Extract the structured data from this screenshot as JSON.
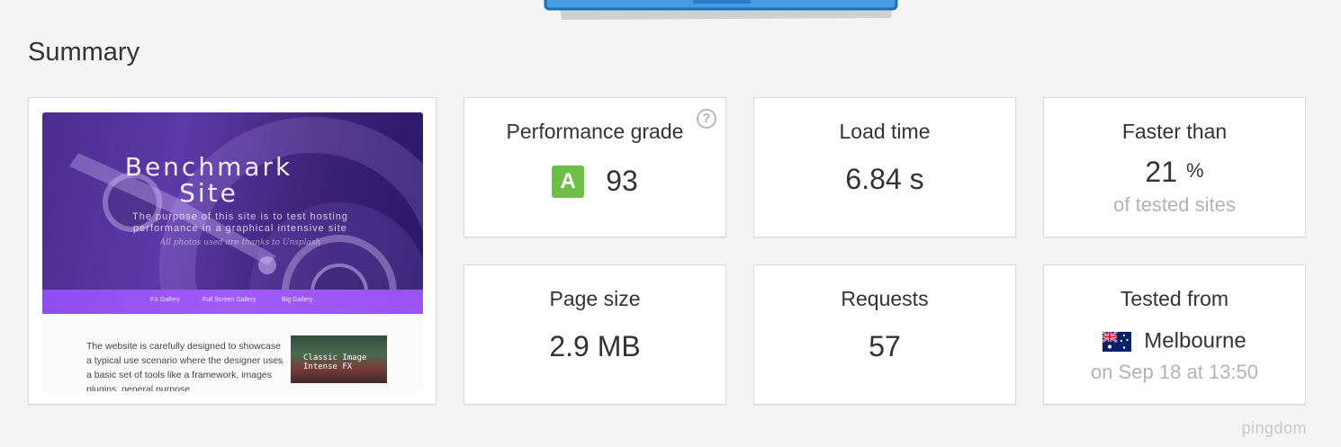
{
  "summary": {
    "title": "Summary"
  },
  "screenshot": {
    "hero_title": "Benchmark Site",
    "hero_subtitle": "The purpose of this site is to test hosting performance in a graphical intensive site",
    "hero_credit": "All photos used are thanks to Unsplash",
    "nav_items": [
      "FX Gallery",
      "Full Screen Gallery",
      "Big Gallery"
    ],
    "body_text": "The website is carefully designed to showcase a typical use scenario where the designer uses a basic set of tools like a framework, images plugins, general purpose",
    "thumb_caption": "Classic Image Intense FX"
  },
  "metrics": {
    "performance": {
      "label": "Performance grade",
      "grade": "A",
      "score": "93",
      "help_icon": "?",
      "grade_color": "#6dbf47"
    },
    "load_time": {
      "label": "Load time",
      "value": "6.84 s"
    },
    "faster_than": {
      "label": "Faster than",
      "value": "21",
      "unit": "%",
      "sub": "of tested sites"
    },
    "page_size": {
      "label": "Page size",
      "value": "2.9 MB"
    },
    "requests": {
      "label": "Requests",
      "value": "57"
    },
    "tested_from": {
      "label": "Tested from",
      "location": "Melbourne",
      "flag": "australia-flag-icon",
      "date": "on Sep 18 at 13:50"
    }
  },
  "brand": {
    "logo_text": "pingdom"
  }
}
